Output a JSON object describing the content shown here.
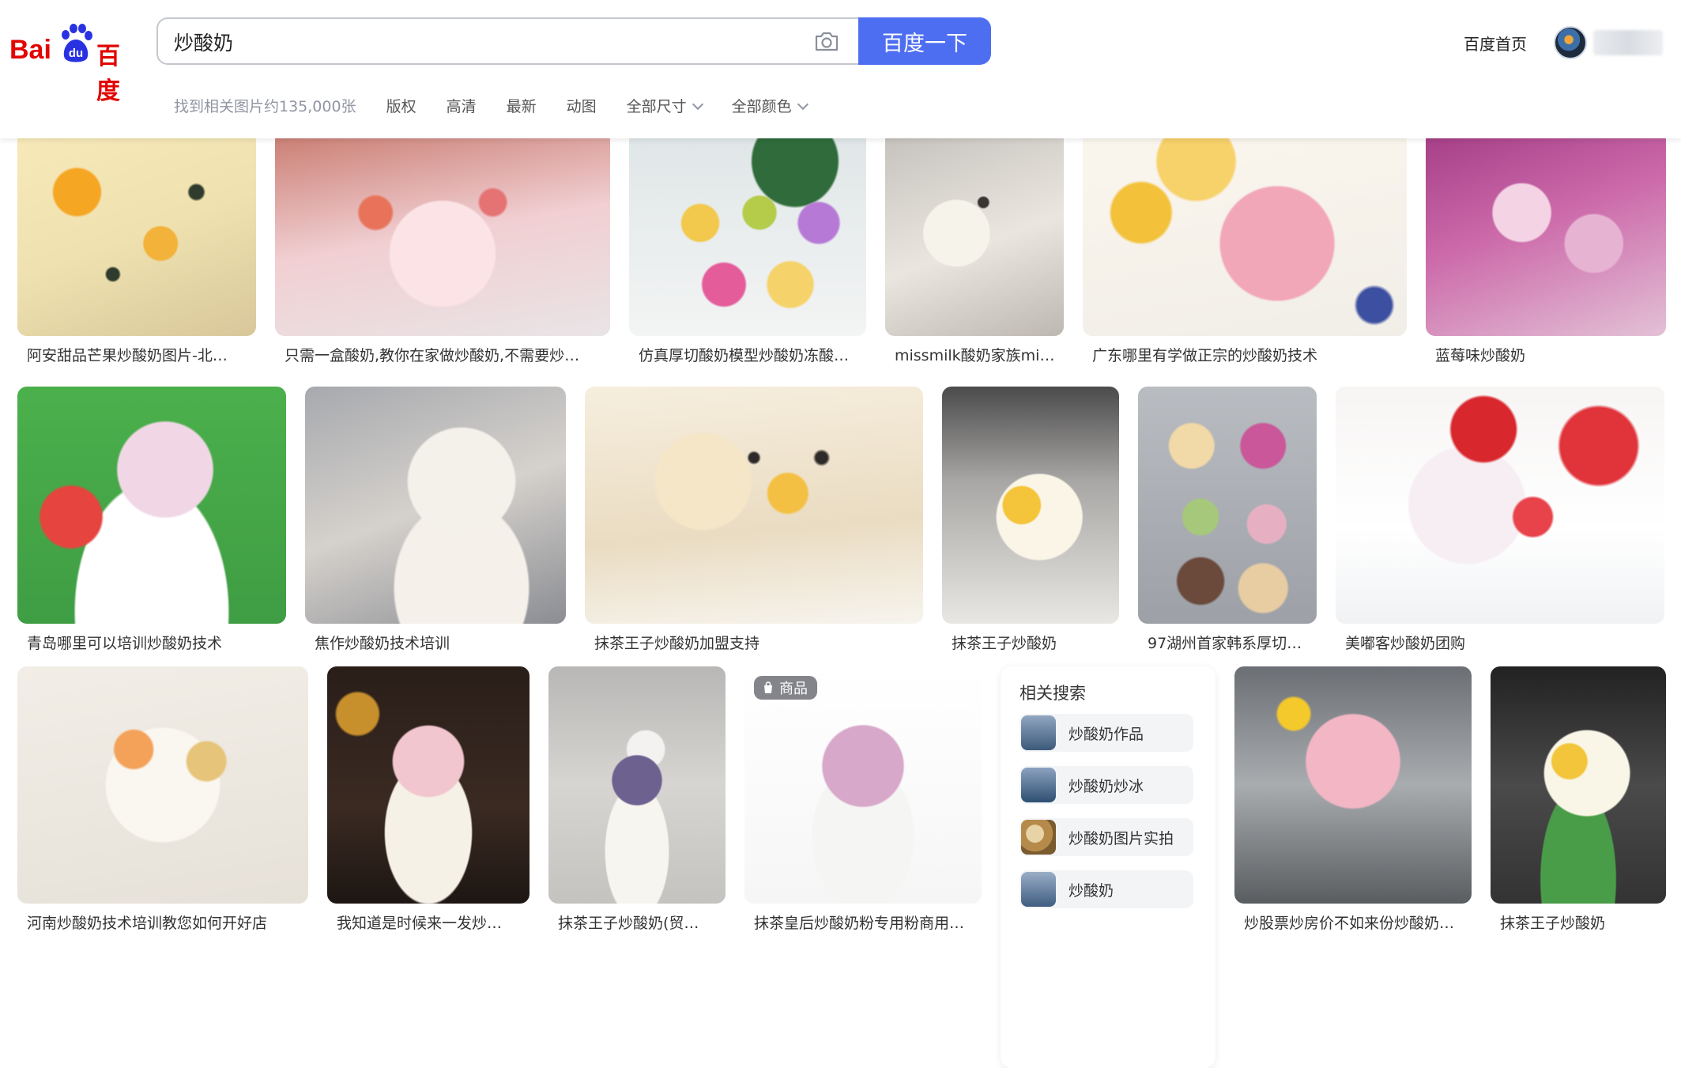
{
  "brand": {
    "logo_text_latin": "Bai",
    "logo_text_du": "du",
    "logo_text_cn": "百度"
  },
  "search": {
    "query": "炒酸奶",
    "button_label": "百度一下"
  },
  "nav": {
    "home_label": "百度首页"
  },
  "filters": {
    "result_count": "找到相关图片约135,000张",
    "items": [
      "版权",
      "高清",
      "最新",
      "动图",
      "全部尺寸",
      "全部颜色"
    ]
  },
  "results": [
    {
      "caption": "阿安甜品芒果炒酸奶图片-北…"
    },
    {
      "caption": "只需一盒酸奶,教你在家做炒酸奶,不需要炒…"
    },
    {
      "caption": "仿真厚切酸奶模型炒酸奶冻酸…"
    },
    {
      "caption": "missmilk酸奶家族mi…"
    },
    {
      "caption": "广东哪里有学做正宗的炒酸奶技术"
    },
    {
      "caption": "蓝莓味炒酸奶"
    },
    {
      "caption": "青岛哪里可以培训炒酸奶技术"
    },
    {
      "caption": "焦作炒酸奶技术培训"
    },
    {
      "caption": "抹茶王子炒酸奶加盟支持"
    },
    {
      "caption": "抹茶王子炒酸奶"
    },
    {
      "caption": "97湖州首家韩系厚切…"
    },
    {
      "caption": "美嘟客炒酸奶团购"
    },
    {
      "caption": "河南炒酸奶技术培训教您如何开好店"
    },
    {
      "caption": "我知道是时候来一发炒…"
    },
    {
      "caption": "抹茶王子炒酸奶(贸…"
    },
    {
      "caption": "抹茶皇后炒酸奶粉专用粉商用…",
      "badge": "商品"
    },
    {
      "caption": "炒股票炒房价不如来份炒酸奶…"
    },
    {
      "caption": "抹茶王子炒酸奶"
    }
  ],
  "related": {
    "title": "相关搜索",
    "items": [
      {
        "label": "炒酸奶作品"
      },
      {
        "label": "炒酸奶炒冰"
      },
      {
        "label": "炒酸奶图片实拍"
      },
      {
        "label": "炒酸奶"
      }
    ]
  },
  "colors": {
    "brand_red": "#e10602",
    "brand_blue": "#2932e1",
    "button_blue": "#4e6ef2"
  }
}
